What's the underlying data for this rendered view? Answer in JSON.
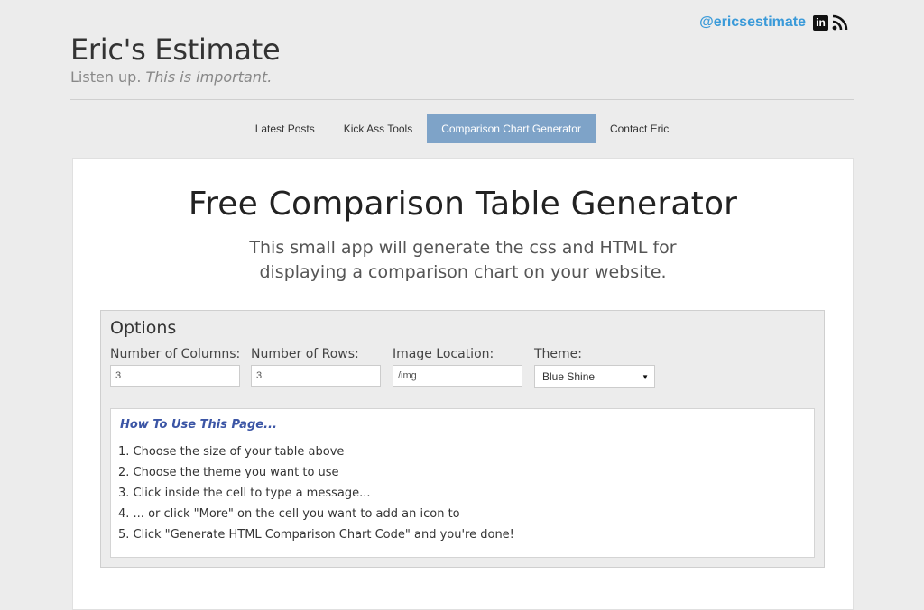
{
  "site": {
    "title": "Eric's Estimate",
    "tagline_plain": "Listen up. ",
    "tagline_italic": "This is important.",
    "twitter_handle": "@ericsestimate",
    "linkedin_glyph": "in"
  },
  "icons": {
    "linkedin": "linkedin-icon",
    "rss": "rss-icon"
  },
  "nav": {
    "items": [
      {
        "label": "Latest Posts",
        "active": false
      },
      {
        "label": "Kick Ass Tools",
        "active": false
      },
      {
        "label": "Comparison Chart Generator",
        "active": true
      },
      {
        "label": "Contact Eric",
        "active": false
      }
    ]
  },
  "page": {
    "title": "Free Comparison Table Generator",
    "subtitle_line1": "This small app will generate the css and HTML for",
    "subtitle_line2": "displaying a comparison chart on your website."
  },
  "options": {
    "title": "Options",
    "columns": {
      "label": "Number of Columns:",
      "value": "3"
    },
    "rows": {
      "label": "Number of Rows:",
      "value": "3"
    },
    "image_location": {
      "label": "Image Location:",
      "value": "/img"
    },
    "theme": {
      "label": "Theme:",
      "selected": "Blue Shine",
      "caret": "▼"
    }
  },
  "howto": {
    "title": "How To Use This Page...",
    "steps": [
      "1.  Choose the size of your table above",
      "2.  Choose the theme you want to use",
      "3.  Click inside the cell to type a message...",
      "4.  ... or click \"More\" on the cell you want to add an icon to",
      "5.  Click \"Generate HTML Comparison Chart Code\" and you're done!"
    ]
  },
  "colors": {
    "background": "#ececec",
    "nav_active_bg": "#7ea3c8",
    "twitter_link": "#3a9ad9",
    "howto_title": "#3b55a5"
  }
}
